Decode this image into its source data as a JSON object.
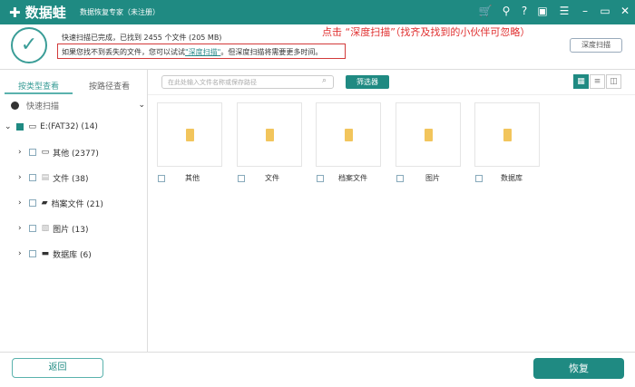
{
  "titlebar": {
    "logo": "✚ 数据蛙",
    "subtitle": "数据恢复专家（未注册）",
    "icons": [
      "cart-icon",
      "key-icon",
      "help-icon",
      "save-icon",
      "menu-icon",
      "minimize-icon",
      "maximize-icon",
      "close-icon"
    ]
  },
  "header": {
    "summary": "快速扫描已完成，已找到 2455 个文件 (205 MB)",
    "hint_pre": "如果您找不到丢失的文件，您可以试试",
    "hint_link": "\"深度扫描\"",
    "hint_post": "。但深度扫描将需要更多时间。",
    "annotation": "点击 “深度扫描”（找齐及找到的小伙伴可忽略）",
    "deep_scan_button": "深度扫描"
  },
  "left": {
    "tabs": [
      "按类型查看",
      "按路径查看"
    ],
    "scan_label": "快速扫描",
    "drive": "E:(FAT32) (14)",
    "items": [
      "其他 (2377)",
      "文件 (38)",
      "档案文件 (21)",
      "图片 (13)",
      "数据库 (6)"
    ]
  },
  "toolbar": {
    "search_placeholder": "在此处输入文件名称或保存路径",
    "filter": "筛选器"
  },
  "cards": [
    "其他",
    "文件",
    "档案文件",
    "图片",
    "数据库"
  ],
  "footer": {
    "back": "返回",
    "recover": "恢复"
  },
  "colors": {
    "accent": "#1f8a82",
    "annotation": "#e03030"
  }
}
